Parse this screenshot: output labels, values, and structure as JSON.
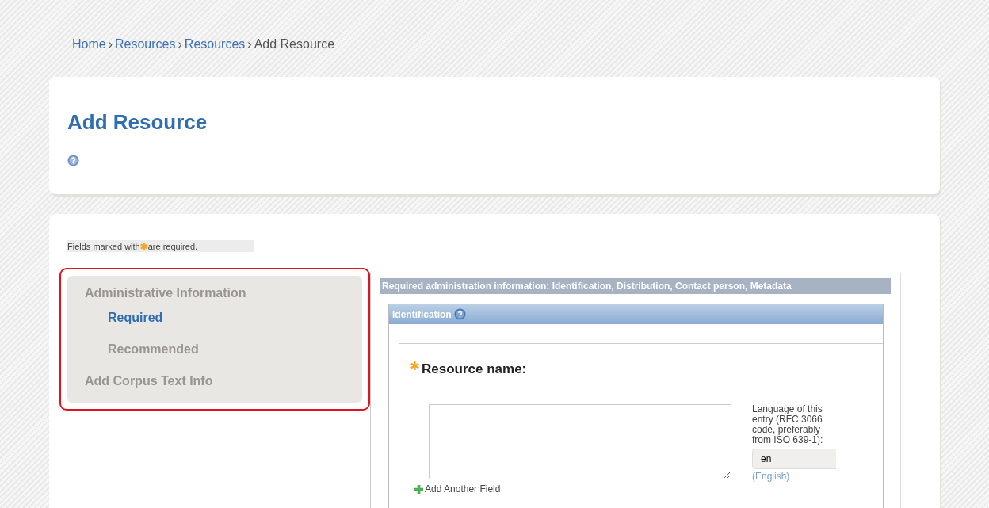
{
  "breadcrumb": [
    {
      "label": "Home",
      "link": true
    },
    {
      "separator": "›",
      "label": "Resources",
      "link": true
    },
    {
      "separator": "›",
      "label": "Resources",
      "link": true
    },
    {
      "separator": "›",
      "label": "Add Resource",
      "link": false
    }
  ],
  "page_title": "Add Resource",
  "required_note": {
    "before": "Fields marked with",
    "after": "are required."
  },
  "sidebar": {
    "items": [
      {
        "label": "Administrative Information",
        "selected": false,
        "children": [
          {
            "label": "Required",
            "selected": true
          },
          {
            "label": "Recommended",
            "selected": false
          }
        ]
      },
      {
        "label": "Add Corpus Text Info",
        "selected": false
      }
    ]
  },
  "section": {
    "title": "Required administration information: Identification, Distribution, Contact person, Metadata",
    "group": {
      "title": "Identification",
      "field": {
        "label": "Resource name:",
        "required": true,
        "language_label": "Language of this entry (RFC 3066 code, preferably from ISO 639-1):",
        "language_value": "en",
        "language_name": "(English)",
        "add_label": "Add Another Field"
      }
    }
  }
}
